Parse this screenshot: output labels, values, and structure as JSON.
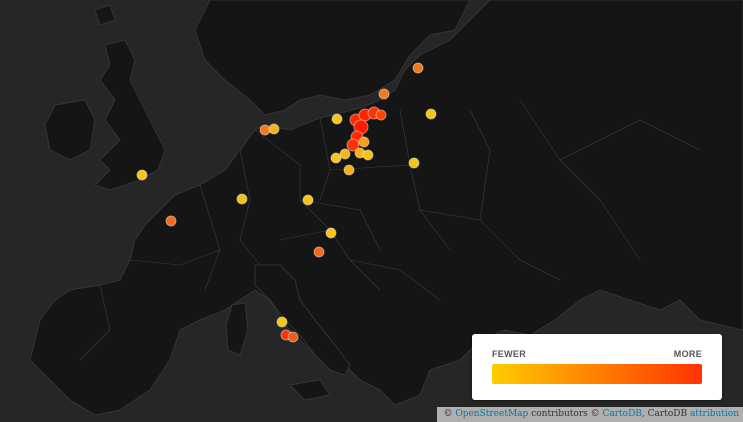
{
  "legend": {
    "min_label": "FEWER",
    "max_label": "MORE",
    "color_low": "#ffcc00",
    "color_high": "#ff3300"
  },
  "attribution": {
    "prefix": "©",
    "osm_link": "OpenStreetMap",
    "contributors": "contributors ©",
    "carto_link": "CartoDB",
    "carto_text": ", CartoDB",
    "attribution_link": "attribution"
  },
  "map_colors": {
    "water": "#262626",
    "land": "#151515",
    "borders": "#3a3a3a"
  },
  "markers": [
    {
      "place": "London",
      "intensity": 0.1
    },
    {
      "place": "Le Mans",
      "intensity": 0.6
    },
    {
      "place": "Luxembourg",
      "intensity": 0.15
    },
    {
      "place": "Hamburg",
      "intensity": 0.55
    },
    {
      "place": "Lübeck",
      "intensity": 0.3
    },
    {
      "place": "Prague",
      "intensity": 0.1
    },
    {
      "place": "Vienna",
      "intensity": 0.2
    },
    {
      "place": "Graz",
      "intensity": 0.6
    },
    {
      "place": "Gdańsk",
      "intensity": 0.85
    },
    {
      "place": "Gdynia",
      "intensity": 0.95
    },
    {
      "place": "Olsztyn",
      "intensity": 0.9
    },
    {
      "place": "Bydgoszcz",
      "intensity": 1.0
    },
    {
      "place": "Toruń",
      "intensity": 0.95
    },
    {
      "place": "Poznań",
      "intensity": 0.2
    },
    {
      "place": "Kalisz",
      "intensity": 0.25
    },
    {
      "place": "Łódź",
      "intensity": 0.3
    },
    {
      "place": "Warsaw",
      "intensity": 0.1
    },
    {
      "place": "Płock",
      "intensity": 0.4
    },
    {
      "place": "Wrocław",
      "intensity": 0.3
    },
    {
      "place": "Lublin",
      "intensity": 0.2
    },
    {
      "place": "Kaunas",
      "intensity": 0.1
    },
    {
      "place": "Vilnius",
      "intensity": 0.55
    },
    {
      "place": "Riga",
      "intensity": 0.6
    },
    {
      "place": "Szczecin",
      "intensity": 0.15
    },
    {
      "place": "Rome",
      "intensity": 0.15
    },
    {
      "place": "Naples",
      "intensity": 0.9
    },
    {
      "place": "Caserta",
      "intensity": 0.7
    }
  ]
}
